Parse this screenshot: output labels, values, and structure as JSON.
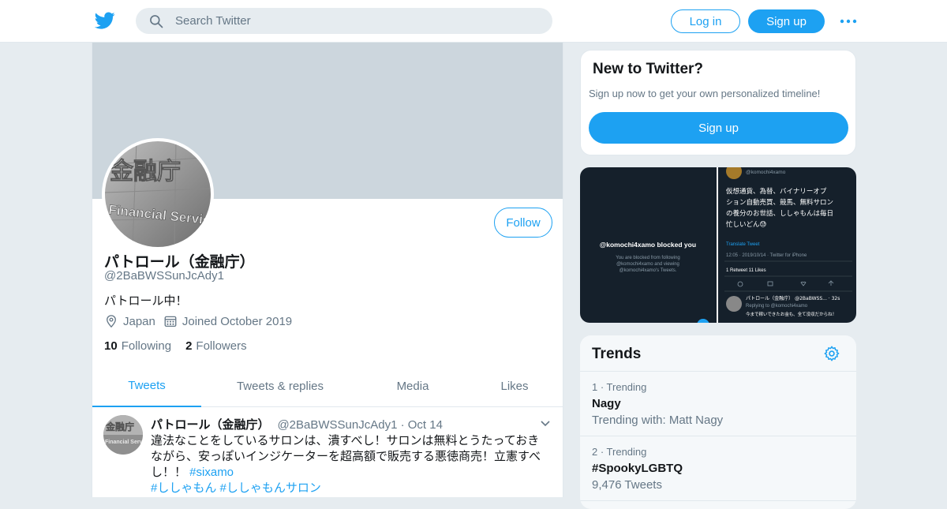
{
  "header": {
    "search_placeholder": "Search Twitter",
    "login_label": "Log in",
    "signup_label": "Sign up"
  },
  "profile": {
    "name": "パトロール（金融庁）",
    "handle": "@2BaBWSSunJcAdy1",
    "bio": "パトロール中！",
    "location": "Japan",
    "joined": "Joined October 2019",
    "following_count": "10",
    "following_label": "Following",
    "followers_count": "2",
    "followers_label": "Followers",
    "follow_label": "Follow",
    "avatar_text_kanji": "金融庁",
    "avatar_text_en": "Financial Servic"
  },
  "tabs": [
    "Tweets",
    "Tweets & replies",
    "Media",
    "Likes"
  ],
  "tweet": {
    "name": "パトロール（金融庁）",
    "handle_date": "@2BaBWSSunJcAdy1 · Oct 14",
    "text": "違法なことをしているサロンは、潰すべし！サロンは無料とうたっておきながら、安っぽいインジケーターを超高額で販売する悪徳商売！立憲すべし！！ ",
    "hashtag1": "#sixamo",
    "hashtag2": "#ししゃもん",
    "hashtag3": "#ししゃもんサロン"
  },
  "sidebar": {
    "new_title": "New to Twitter?",
    "new_text": "Sign up now to get your own personalized timeline!",
    "new_signup": "Sign up",
    "media": {
      "left_title": "@komochi4xamo blocked you",
      "left_line1": "You are blocked from following",
      "left_line2": "@komochi4xamo and viewing",
      "left_line3": "@komochi4xamo's Tweets.",
      "right_handle": "@komochi4xamo",
      "right_line1": "仮想通貨、為替、バイナリーオプ",
      "right_line2": "ション自動売買、競馬、無料サロン",
      "right_line3": "の養分のお世話、ししゃもんは毎日",
      "right_line4": "忙しいどん😓",
      "right_translate": "Translate Tweet",
      "right_time": "12:05 · 2019/10/14 · Twitter for iPhone",
      "right_stats": "1 Retweet  11 Likes",
      "right_reply_name": "パトロール（金融庁） @2BaBWSS... · 32s",
      "right_reply_to": "Replying to @komochi4xamo",
      "right_reply_text": "今まで稼いできたお金も、全て没収だからね！"
    }
  },
  "trends": {
    "title": "Trends",
    "items": [
      {
        "meta": "1 · Trending",
        "name": "Nagy",
        "sub": "Trending with: Matt Nagy"
      },
      {
        "meta": "2 · Trending",
        "name": "#SpookyLGBTQ",
        "sub": "9,476 Tweets"
      }
    ]
  },
  "colors": {
    "accent": "#1da1f2",
    "muted": "#657786",
    "background": "#e6ecf0",
    "banner": "#ccd6dd"
  },
  "icons": [
    "twitter-bird-icon",
    "search-icon",
    "more-dots-icon",
    "location-icon",
    "calendar-icon",
    "chevron-down-icon",
    "gear-icon"
  ]
}
